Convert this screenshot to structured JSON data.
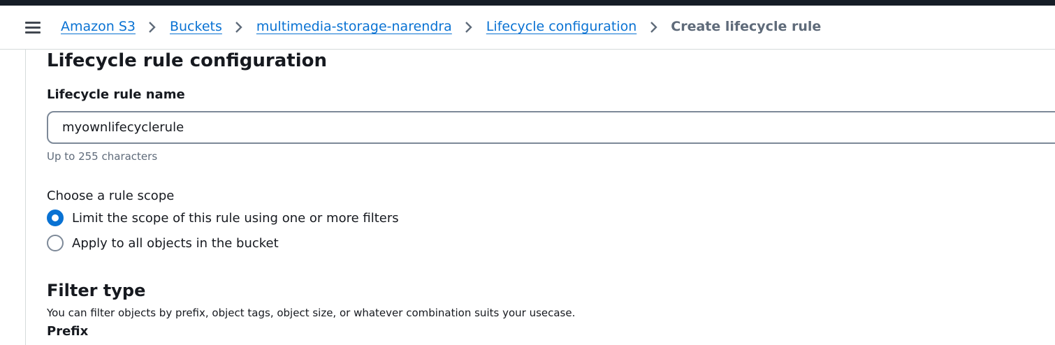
{
  "header": {
    "breadcrumb": [
      {
        "label": "Amazon S3",
        "link": true
      },
      {
        "label": "Buckets",
        "link": true
      },
      {
        "label": "multimedia-storage-narendra",
        "link": true
      },
      {
        "label": "Lifecycle configuration",
        "link": true
      },
      {
        "label": "Create lifecycle rule",
        "link": false
      }
    ]
  },
  "section": {
    "title": "Lifecycle rule configuration",
    "name_label": "Lifecycle rule name",
    "name_value": "myownlifecyclerule",
    "name_hint": "Up to 255 characters",
    "scope_label": "Choose a rule scope",
    "scope_options": [
      {
        "label": "Limit the scope of this rule using one or more filters",
        "selected": true
      },
      {
        "label": "Apply to all objects in the bucket",
        "selected": false
      }
    ]
  },
  "filter": {
    "title": "Filter type",
    "description": "You can filter objects by prefix, object tags, object size, or whatever combination suits your usecase.",
    "prefix_label": "Prefix"
  },
  "colors": {
    "link": "#0972d3",
    "radio_selected": "#0972d3",
    "top_strip": "#161d26"
  }
}
